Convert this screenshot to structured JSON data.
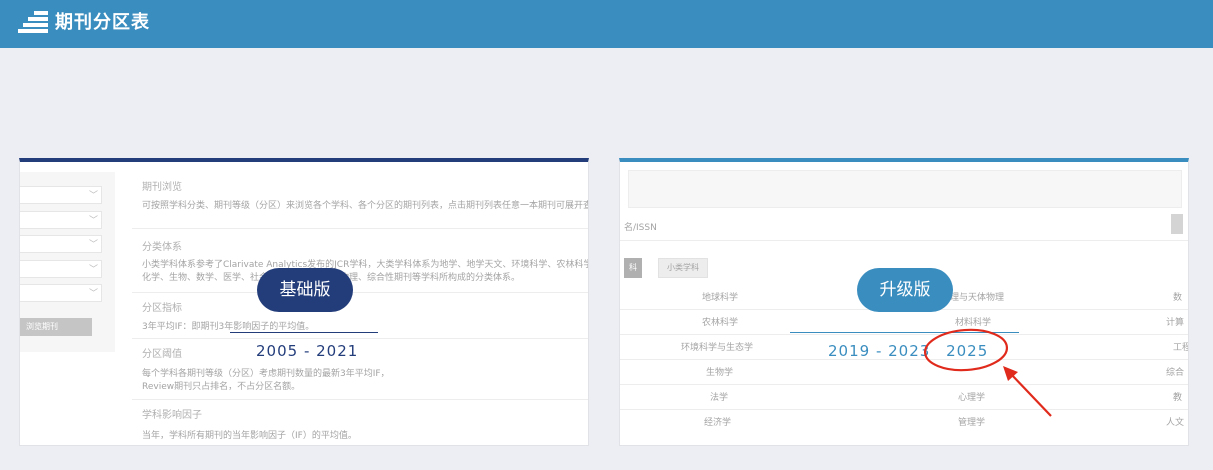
{
  "header": {
    "title": "期刊分区表",
    "logo_icon": "stacked-bars-logo",
    "bg_color": "#3a8dbf"
  },
  "basic": {
    "badge": "基础版",
    "range": "2005 - 2021",
    "accent": "#233d7b",
    "browse_button": "浏览期刊",
    "sections": [
      {
        "heading": "期刊浏览",
        "text": [
          "可按照学科分类、期刊等级（分区）来浏览各个学科、各个分区的期刊列表，点击期刊列表任意一本期刊可展开查看。"
        ]
      },
      {
        "heading": "分类体系",
        "text": [
          "小类学科体系参考了Clarivate Analytics发布的JCR学科，大类学科体系为地学、地学天文、环境科学、农林科学、",
          "化学、生物、数学、医学、社会科学、工程技术、物理、综合性期刊等学科所构成的分类体系。"
        ]
      },
      {
        "heading": "分区指标",
        "text": [
          "3年平均IF：即期刊3年影响因子的平均值。"
        ]
      },
      {
        "heading": "分区阈值",
        "text": [
          "每个学科各期刊等级（分区）考虑期刊数量的最新3年平均IF，",
          "Review期刊只占排名，不占分区名额。"
        ]
      },
      {
        "heading": "学科影响因子",
        "text": [
          "当年，学科所有期刊的当年影响因子（IF）的平均值。"
        ]
      }
    ]
  },
  "upgrade": {
    "badge": "升级版",
    "range": "2019 - 2023",
    "range_extra": "2025",
    "accent": "#3a8dbf",
    "search_hint": "名/ISSN",
    "tags": [
      "科",
      "小类学科"
    ],
    "subjects": [
      [
        "地球科学",
        "理与天体物理",
        "数"
      ],
      [
        "农林科学",
        "材料科学",
        "计算"
      ],
      [
        "环境科学与生态学",
        "",
        "工程"
      ],
      [
        "生物学",
        "",
        "综合"
      ],
      [
        "法学",
        "心理学",
        "教"
      ],
      [
        "经济学",
        "管理学",
        "人文"
      ]
    ]
  },
  "annotation": {
    "color": "#e02a1c",
    "type": "circle-with-arrow"
  }
}
